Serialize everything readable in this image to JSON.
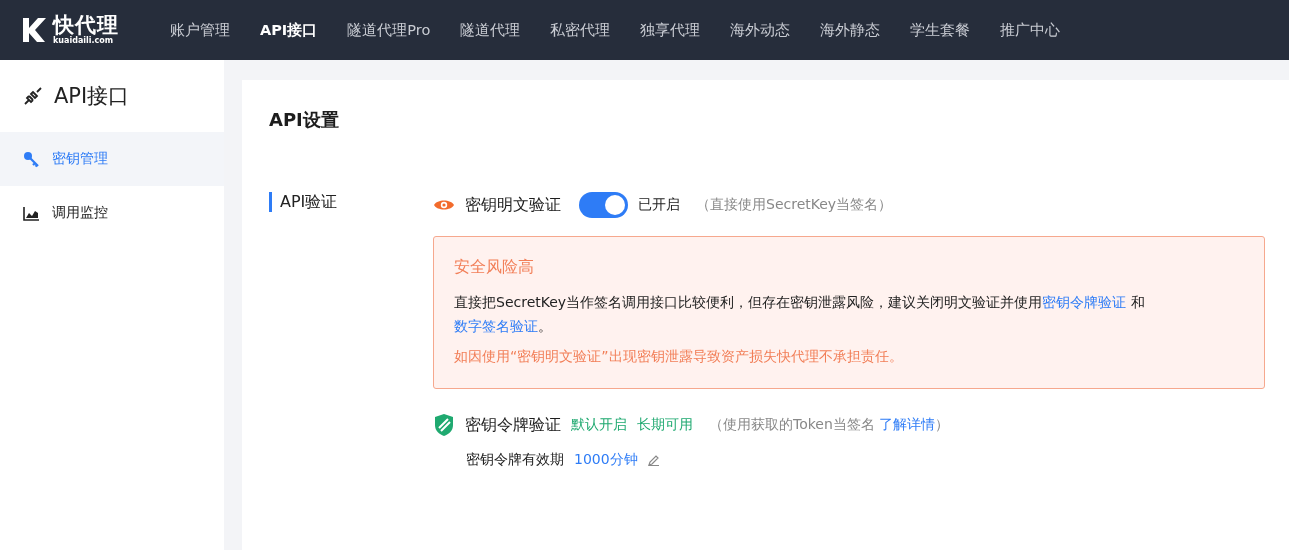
{
  "header": {
    "logo": {
      "name": "快代理",
      "domain": "kuaidaili.com"
    },
    "nav": [
      {
        "label": "账户管理",
        "selected": false
      },
      {
        "label": "API接口",
        "selected": true
      },
      {
        "label": "隧道代理Pro",
        "selected": false
      },
      {
        "label": "隧道代理",
        "selected": false
      },
      {
        "label": "私密代理",
        "selected": false
      },
      {
        "label": "独享代理",
        "selected": false
      },
      {
        "label": "海外动态",
        "selected": false
      },
      {
        "label": "海外静态",
        "selected": false
      },
      {
        "label": "学生套餐",
        "selected": false
      },
      {
        "label": "推广中心",
        "selected": false
      }
    ]
  },
  "sidebar": {
    "title": "API接口",
    "items": [
      {
        "label": "密钥管理",
        "selected": true,
        "kind": "key"
      },
      {
        "label": "调用监控",
        "selected": false,
        "kind": "chart"
      }
    ]
  },
  "main": {
    "title": "API设置",
    "section": "API验证",
    "plaintext": {
      "label": "密钥明文验证",
      "switch": {
        "on": true
      },
      "status": "已开启",
      "hint": "（直接使用SecretKey当签名）",
      "alert": {
        "title": "安全风险高",
        "body": [
          {
            "kind": "text",
            "text": "直接把SecretKey当作签名调用接口比较便利，但存在密钥泄露风险，建议关闭明文验证并使用"
          },
          {
            "kind": "link",
            "text": "密钥令牌验证"
          },
          {
            "kind": "text",
            "text": " 和 "
          },
          {
            "kind": "link",
            "text": "数字签名验证"
          },
          {
            "kind": "text",
            "text": "。"
          }
        ],
        "warning": "如因使用“密钥明文验证”出现密钥泄露导致资产损失快代理不承担责任。"
      }
    },
    "token": {
      "label": "密钥令牌验证",
      "tags": [
        "默认开启",
        "长期可用"
      ],
      "hint": "（使用获取的Token当签名",
      "link": "了解详情",
      "hint_end": "）",
      "validity": {
        "label": "密钥令牌有效期",
        "value": "1000分钟"
      }
    }
  }
}
